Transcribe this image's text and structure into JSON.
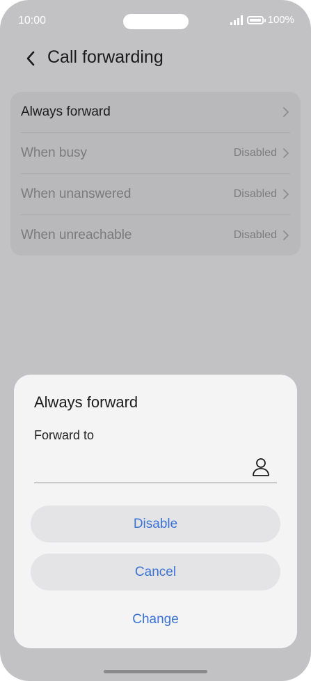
{
  "status_bar": {
    "time": "10:00",
    "battery": "100%"
  },
  "header": {
    "title": "Call forwarding"
  },
  "list": {
    "items": [
      {
        "label": "Always forward",
        "status": ""
      },
      {
        "label": "When busy",
        "status": "Disabled"
      },
      {
        "label": "When unanswered",
        "status": "Disabled"
      },
      {
        "label": "When unreachable",
        "status": "Disabled"
      }
    ]
  },
  "dialog": {
    "title": "Always forward",
    "field_label": "Forward to",
    "field_value": "",
    "buttons": {
      "disable": "Disable",
      "cancel": "Cancel",
      "change": "Change"
    }
  },
  "colors": {
    "accent": "#3a72d6",
    "scrim": "#c2c2c4",
    "sheet": "#f4f4f5"
  }
}
